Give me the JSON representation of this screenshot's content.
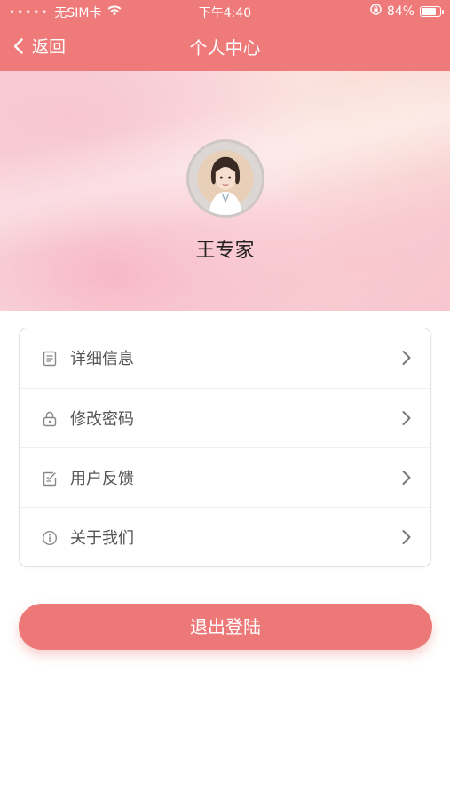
{
  "status_bar": {
    "signal": "•••••",
    "carrier": "无SIM卡",
    "time": "下午4:40",
    "battery_percent": "84%",
    "battery_level": 0.84
  },
  "header": {
    "back_label": "返回",
    "title": "个人中心"
  },
  "profile": {
    "name": "王专家"
  },
  "menu": {
    "items": [
      {
        "label": "详细信息",
        "icon": "details-doc-icon"
      },
      {
        "label": "修改密码",
        "icon": "lock-icon"
      },
      {
        "label": "用户反馈",
        "icon": "feedback-edit-icon"
      },
      {
        "label": "关于我们",
        "icon": "info-icon"
      }
    ]
  },
  "actions": {
    "logout_label": "退出登陆"
  },
  "colors": {
    "accent": "#ee7a79",
    "button": "#ec7878"
  }
}
